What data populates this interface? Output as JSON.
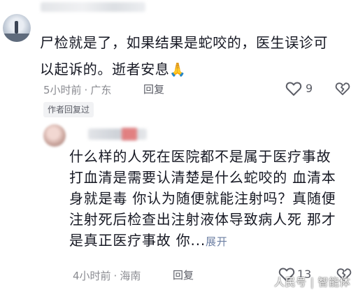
{
  "comment1": {
    "text_line1": "尸检就是了，如果结果是蛇咬的，医生误诊可",
    "text_line2": "以起诉的。逝者安息",
    "emoji": "🙏",
    "time": "5小时前",
    "location": "广东",
    "reply_label": "回复",
    "like_count": "9",
    "author_replied_badge": "作者回复过"
  },
  "comment2": {
    "lines": [
      "什么样的人死在医院都不是属于医疗事故",
      "打血清是需要认清楚是什么蛇咬的 血清本",
      "身就是毒 你认为随便就能注射吗？真随便",
      "注射死后检查出注射液体导致病人死 那才",
      "是真正医疗事故 你..."
    ],
    "expand_label": "展开",
    "time": "4小时前",
    "location": "海南",
    "reply_label": "回复",
    "like_count": "13"
  },
  "meta_separator": "·",
  "watermark": "人民号 | 智能体",
  "icons": {
    "like": "heart-outline-icon",
    "dislike": "broken-heart-icon",
    "emoji": "folded-hands-icon"
  },
  "colors": {
    "text": "#161823",
    "meta": "#8a8b91",
    "link": "#6d7fa3"
  }
}
